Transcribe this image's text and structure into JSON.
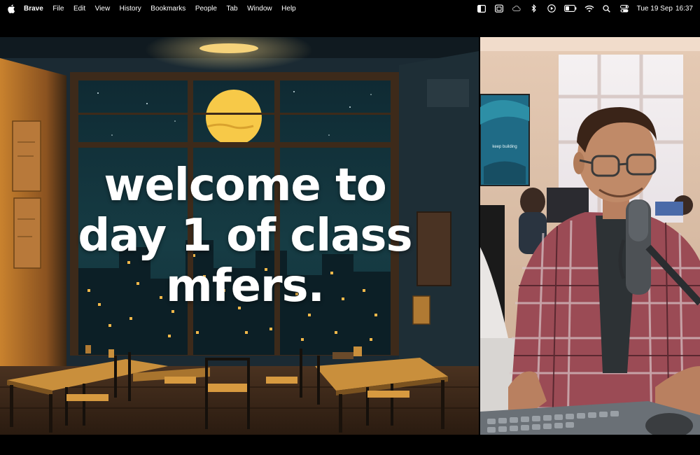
{
  "menubar": {
    "app_name": "Brave",
    "items": [
      "File",
      "Edit",
      "View",
      "History",
      "Bookmarks",
      "People",
      "Tab",
      "Window",
      "Help"
    ],
    "status_icons": [
      "sidebar-icon",
      "calendar-icon",
      "creative-cloud-icon",
      "bluetooth-icon",
      "play-icon",
      "battery-icon",
      "wifi-icon",
      "search-icon",
      "control-center-icon"
    ],
    "date": "Tue 19 Sep",
    "time": "16:37"
  },
  "stream": {
    "overlay_lines": [
      "welcome to",
      "day 1 of class",
      "mfers."
    ],
    "poster_text": "keep building"
  },
  "colors": {
    "menubar_bg": "#000000",
    "scene_wall": "#1b2a33",
    "lamp": "#f5d27a",
    "moon": "#f7c948",
    "shirt": "#9b4b55"
  }
}
